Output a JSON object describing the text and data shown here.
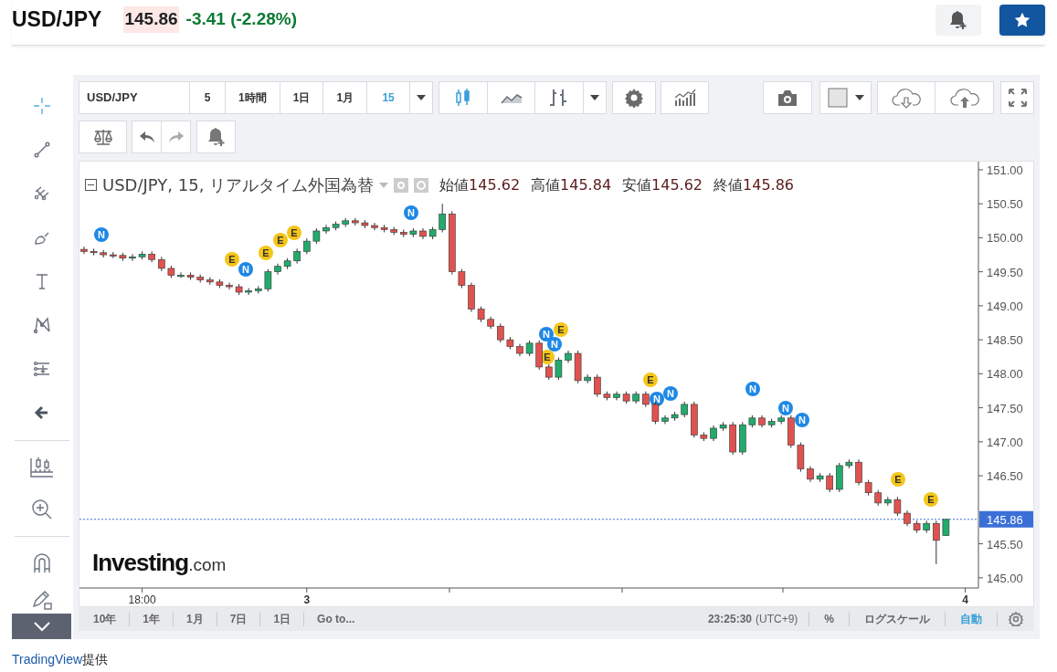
{
  "header": {
    "symbol": "USD/JPY",
    "price": "145.86",
    "change": "-3.41 (-2.28%)"
  },
  "toolbar": {
    "symbol": "USD/JPY",
    "intervals": [
      {
        "label": "5",
        "selected": false
      },
      {
        "label": "1時間",
        "selected": false
      },
      {
        "label": "1日",
        "selected": false
      },
      {
        "label": "1月",
        "selected": false
      },
      {
        "label": "15",
        "selected": true
      }
    ],
    "chart_types": [
      {
        "kind": "candles",
        "selected": true
      },
      {
        "kind": "area",
        "selected": false
      },
      {
        "kind": "bars",
        "selected": false
      }
    ],
    "history_buttons": [
      {
        "kind": "undo",
        "disabled": false
      },
      {
        "kind": "redo",
        "disabled": true
      }
    ]
  },
  "legend": {
    "title": "USD/JPY, 15, リアルタイム外国為替",
    "ohlc": [
      {
        "label": "始値",
        "value": "145.62"
      },
      {
        "label": "高値",
        "value": "145.84"
      },
      {
        "label": "安値",
        "value": "145.62"
      },
      {
        "label": "終値",
        "value": "145.86"
      }
    ]
  },
  "chart": {
    "logo": {
      "name": "Investing",
      "suffix": ".com"
    },
    "chart_data": {
      "type": "candlestick",
      "categories": [
        null,
        null,
        null,
        null,
        null,
        null,
        "18:00",
        null,
        null,
        null,
        null,
        null,
        null,
        null,
        null,
        null,
        null,
        null,
        null,
        null,
        null,
        null,
        null,
        "3",
        null,
        null,
        null,
        null,
        null,
        null,
        null,
        null,
        null,
        null,
        null,
        null,
        null,
        null,
        null,
        null,
        null,
        null,
        null,
        null,
        null,
        null,
        null,
        null,
        null,
        null,
        null,
        null,
        null,
        null,
        null,
        null,
        null,
        null,
        null,
        null,
        null,
        null,
        null,
        null,
        null,
        null,
        null,
        null,
        null,
        null,
        null,
        null,
        null,
        null,
        null,
        null,
        null,
        null,
        null,
        null,
        null,
        null,
        null,
        null,
        null,
        null,
        null,
        null,
        null,
        null,
        null,
        "4"
      ],
      "ohlc": [
        [
          149.83,
          149.87,
          149.76,
          149.8
        ],
        [
          149.8,
          149.84,
          149.74,
          149.78
        ],
        [
          149.78,
          149.82,
          149.71,
          149.75
        ],
        [
          149.75,
          149.79,
          149.7,
          149.74
        ],
        [
          149.74,
          149.78,
          149.66,
          149.7
        ],
        [
          149.7,
          149.76,
          149.66,
          149.72
        ],
        [
          149.72,
          149.8,
          149.68,
          149.76
        ],
        [
          149.76,
          149.8,
          149.64,
          149.68
        ],
        [
          149.68,
          149.72,
          149.51,
          149.55
        ],
        [
          149.55,
          149.59,
          149.41,
          149.45
        ],
        [
          149.45,
          149.49,
          149.41,
          149.45
        ],
        [
          149.45,
          149.49,
          149.38,
          149.42
        ],
        [
          149.42,
          149.46,
          149.34,
          149.38
        ],
        [
          149.38,
          149.42,
          149.31,
          149.35
        ],
        [
          149.35,
          149.39,
          149.26,
          149.3
        ],
        [
          149.3,
          149.34,
          149.24,
          149.28
        ],
        [
          149.28,
          149.32,
          149.16,
          149.2
        ],
        [
          149.2,
          149.26,
          149.16,
          149.22
        ],
        [
          149.22,
          149.29,
          149.18,
          149.25
        ],
        [
          149.25,
          149.54,
          149.21,
          149.5
        ],
        [
          149.5,
          149.62,
          149.46,
          149.58
        ],
        [
          149.58,
          149.7,
          149.54,
          149.66
        ],
        [
          149.66,
          149.84,
          149.62,
          149.8
        ],
        [
          149.8,
          149.99,
          149.76,
          149.95
        ],
        [
          149.95,
          150.14,
          149.91,
          150.1
        ],
        [
          150.1,
          150.19,
          150.06,
          150.15
        ],
        [
          150.15,
          150.24,
          150.11,
          150.2
        ],
        [
          150.2,
          150.29,
          150.16,
          150.25
        ],
        [
          150.25,
          150.29,
          150.18,
          150.22
        ],
        [
          150.22,
          150.26,
          150.14,
          150.18
        ],
        [
          150.18,
          150.22,
          150.11,
          150.15
        ],
        [
          150.15,
          150.19,
          150.08,
          150.12
        ],
        [
          150.12,
          150.16,
          150.04,
          150.08
        ],
        [
          150.08,
          150.12,
          150.01,
          150.05
        ],
        [
          150.05,
          150.14,
          150.01,
          150.1
        ],
        [
          150.1,
          150.14,
          149.98,
          150.02
        ],
        [
          150.02,
          150.16,
          149.98,
          150.12
        ],
        [
          150.12,
          150.5,
          150.08,
          150.35
        ],
        [
          150.35,
          150.39,
          149.46,
          149.5
        ],
        [
          149.5,
          149.54,
          149.26,
          149.3
        ],
        [
          149.3,
          149.34,
          148.91,
          148.95
        ],
        [
          148.95,
          148.99,
          148.76,
          148.8
        ],
        [
          148.8,
          148.84,
          148.66,
          148.7
        ],
        [
          148.7,
          148.74,
          148.46,
          148.5
        ],
        [
          148.5,
          148.54,
          148.36,
          148.4
        ],
        [
          148.4,
          148.44,
          148.26,
          148.3
        ],
        [
          148.3,
          148.49,
          148.26,
          148.45
        ],
        [
          148.45,
          148.49,
          148.06,
          148.1
        ],
        [
          148.1,
          148.14,
          147.91,
          147.95
        ],
        [
          147.95,
          148.24,
          147.91,
          148.2
        ],
        [
          148.2,
          148.34,
          148.16,
          148.3
        ],
        [
          148.3,
          148.34,
          147.86,
          147.9
        ],
        [
          147.9,
          147.99,
          147.86,
          147.95
        ],
        [
          147.95,
          147.99,
          147.66,
          147.7
        ],
        [
          147.7,
          147.74,
          147.61,
          147.65
        ],
        [
          147.65,
          147.74,
          147.61,
          147.7
        ],
        [
          147.7,
          147.74,
          147.56,
          147.6
        ],
        [
          147.6,
          147.74,
          147.56,
          147.7
        ],
        [
          147.7,
          147.74,
          147.51,
          147.55
        ],
        [
          147.55,
          147.59,
          147.26,
          147.3
        ],
        [
          147.3,
          147.39,
          147.26,
          147.35
        ],
        [
          147.35,
          147.44,
          147.31,
          147.4
        ],
        [
          147.4,
          147.59,
          147.36,
          147.55
        ],
        [
          147.55,
          147.59,
          147.06,
          147.1
        ],
        [
          147.1,
          147.14,
          147.01,
          147.05
        ],
        [
          147.05,
          147.24,
          147.01,
          147.2
        ],
        [
          147.2,
          147.29,
          147.16,
          147.25
        ],
        [
          147.25,
          147.29,
          146.81,
          146.85
        ],
        [
          146.85,
          147.29,
          146.81,
          147.25
        ],
        [
          147.25,
          147.39,
          147.21,
          147.35
        ],
        [
          147.35,
          147.39,
          147.21,
          147.25
        ],
        [
          147.25,
          147.34,
          147.21,
          147.3
        ],
        [
          147.3,
          147.39,
          147.26,
          147.35
        ],
        [
          147.35,
          147.39,
          146.91,
          146.95
        ],
        [
          146.95,
          146.99,
          146.56,
          146.6
        ],
        [
          146.6,
          146.64,
          146.41,
          146.45
        ],
        [
          146.45,
          146.54,
          146.41,
          146.5
        ],
        [
          146.5,
          146.54,
          146.26,
          146.3
        ],
        [
          146.3,
          146.69,
          146.26,
          146.65
        ],
        [
          146.65,
          146.74,
          146.61,
          146.7
        ],
        [
          146.7,
          146.74,
          146.36,
          146.4
        ],
        [
          146.4,
          146.44,
          146.21,
          146.25
        ],
        [
          146.25,
          146.29,
          146.06,
          146.1
        ],
        [
          146.1,
          146.19,
          146.06,
          146.15
        ],
        [
          146.15,
          146.19,
          145.91,
          145.95
        ],
        [
          145.95,
          145.99,
          145.76,
          145.8
        ],
        [
          145.8,
          145.84,
          145.66,
          145.7
        ],
        [
          145.7,
          145.84,
          145.66,
          145.8
        ],
        [
          145.8,
          145.84,
          145.2,
          145.55
        ],
        [
          145.62,
          145.86,
          145.62,
          145.86
        ],
        null,
        null
      ],
      "ylim": [
        144.85,
        151.12
      ],
      "yticks": [
        {
          "value": 151,
          "label": "151.00"
        },
        {
          "value": 150.5,
          "label": "150.50"
        },
        {
          "value": 150,
          "label": "150.00"
        },
        {
          "value": 149.5,
          "label": "149.50"
        },
        {
          "value": 149,
          "label": "149.00"
        },
        {
          "value": 148.5,
          "label": "148.50"
        },
        {
          "value": 148,
          "label": "148.00"
        },
        {
          "value": 147.5,
          "label": "147.50"
        },
        {
          "value": 147,
          "label": "147.00"
        },
        {
          "value": 146.5,
          "label": "146.50"
        },
        {
          "value": 145.5,
          "label": "145.50"
        },
        {
          "value": 145,
          "label": "145.00"
        }
      ],
      "ref_lines": [
        {
          "axis": "y",
          "value": 145.86,
          "label": "145.86"
        }
      ],
      "annotations": [
        "N",
        "E",
        "N",
        "E",
        "E",
        "E",
        "N",
        "N",
        "E",
        "N",
        "E",
        "E",
        "N",
        "N",
        "N",
        "N",
        "N",
        "E",
        "E"
      ]
    }
  },
  "bottom_bar": {
    "ranges": [
      "10年",
      "1年",
      "1月",
      "7日",
      "1日",
      "Go to..."
    ],
    "time": "23:25:30",
    "timezone": "(UTC+9)",
    "scale_options": [
      {
        "label": "%",
        "selected": false
      },
      {
        "label": "ログスケール",
        "selected": false
      },
      {
        "label": "自動",
        "selected": true
      }
    ]
  },
  "footer": {
    "link": "TradingView",
    "suffix": "提供"
  }
}
